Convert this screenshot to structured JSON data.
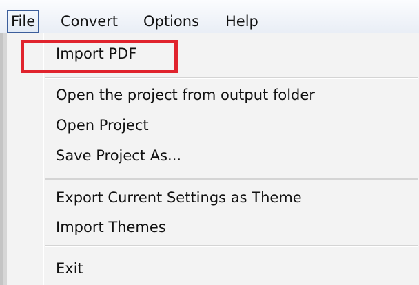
{
  "menubar": {
    "file": "File",
    "convert": "Convert",
    "options": "Options",
    "help": "Help"
  },
  "file_menu": {
    "import_pdf": "Import PDF",
    "open_from_output": "Open the project from output folder",
    "open_project": "Open Project",
    "save_project_as": "Save Project As...",
    "export_theme": "Export Current Settings as Theme",
    "import_themes": "Import Themes",
    "exit": "Exit"
  },
  "annotation": {
    "highlight_color": "#e0232d"
  }
}
